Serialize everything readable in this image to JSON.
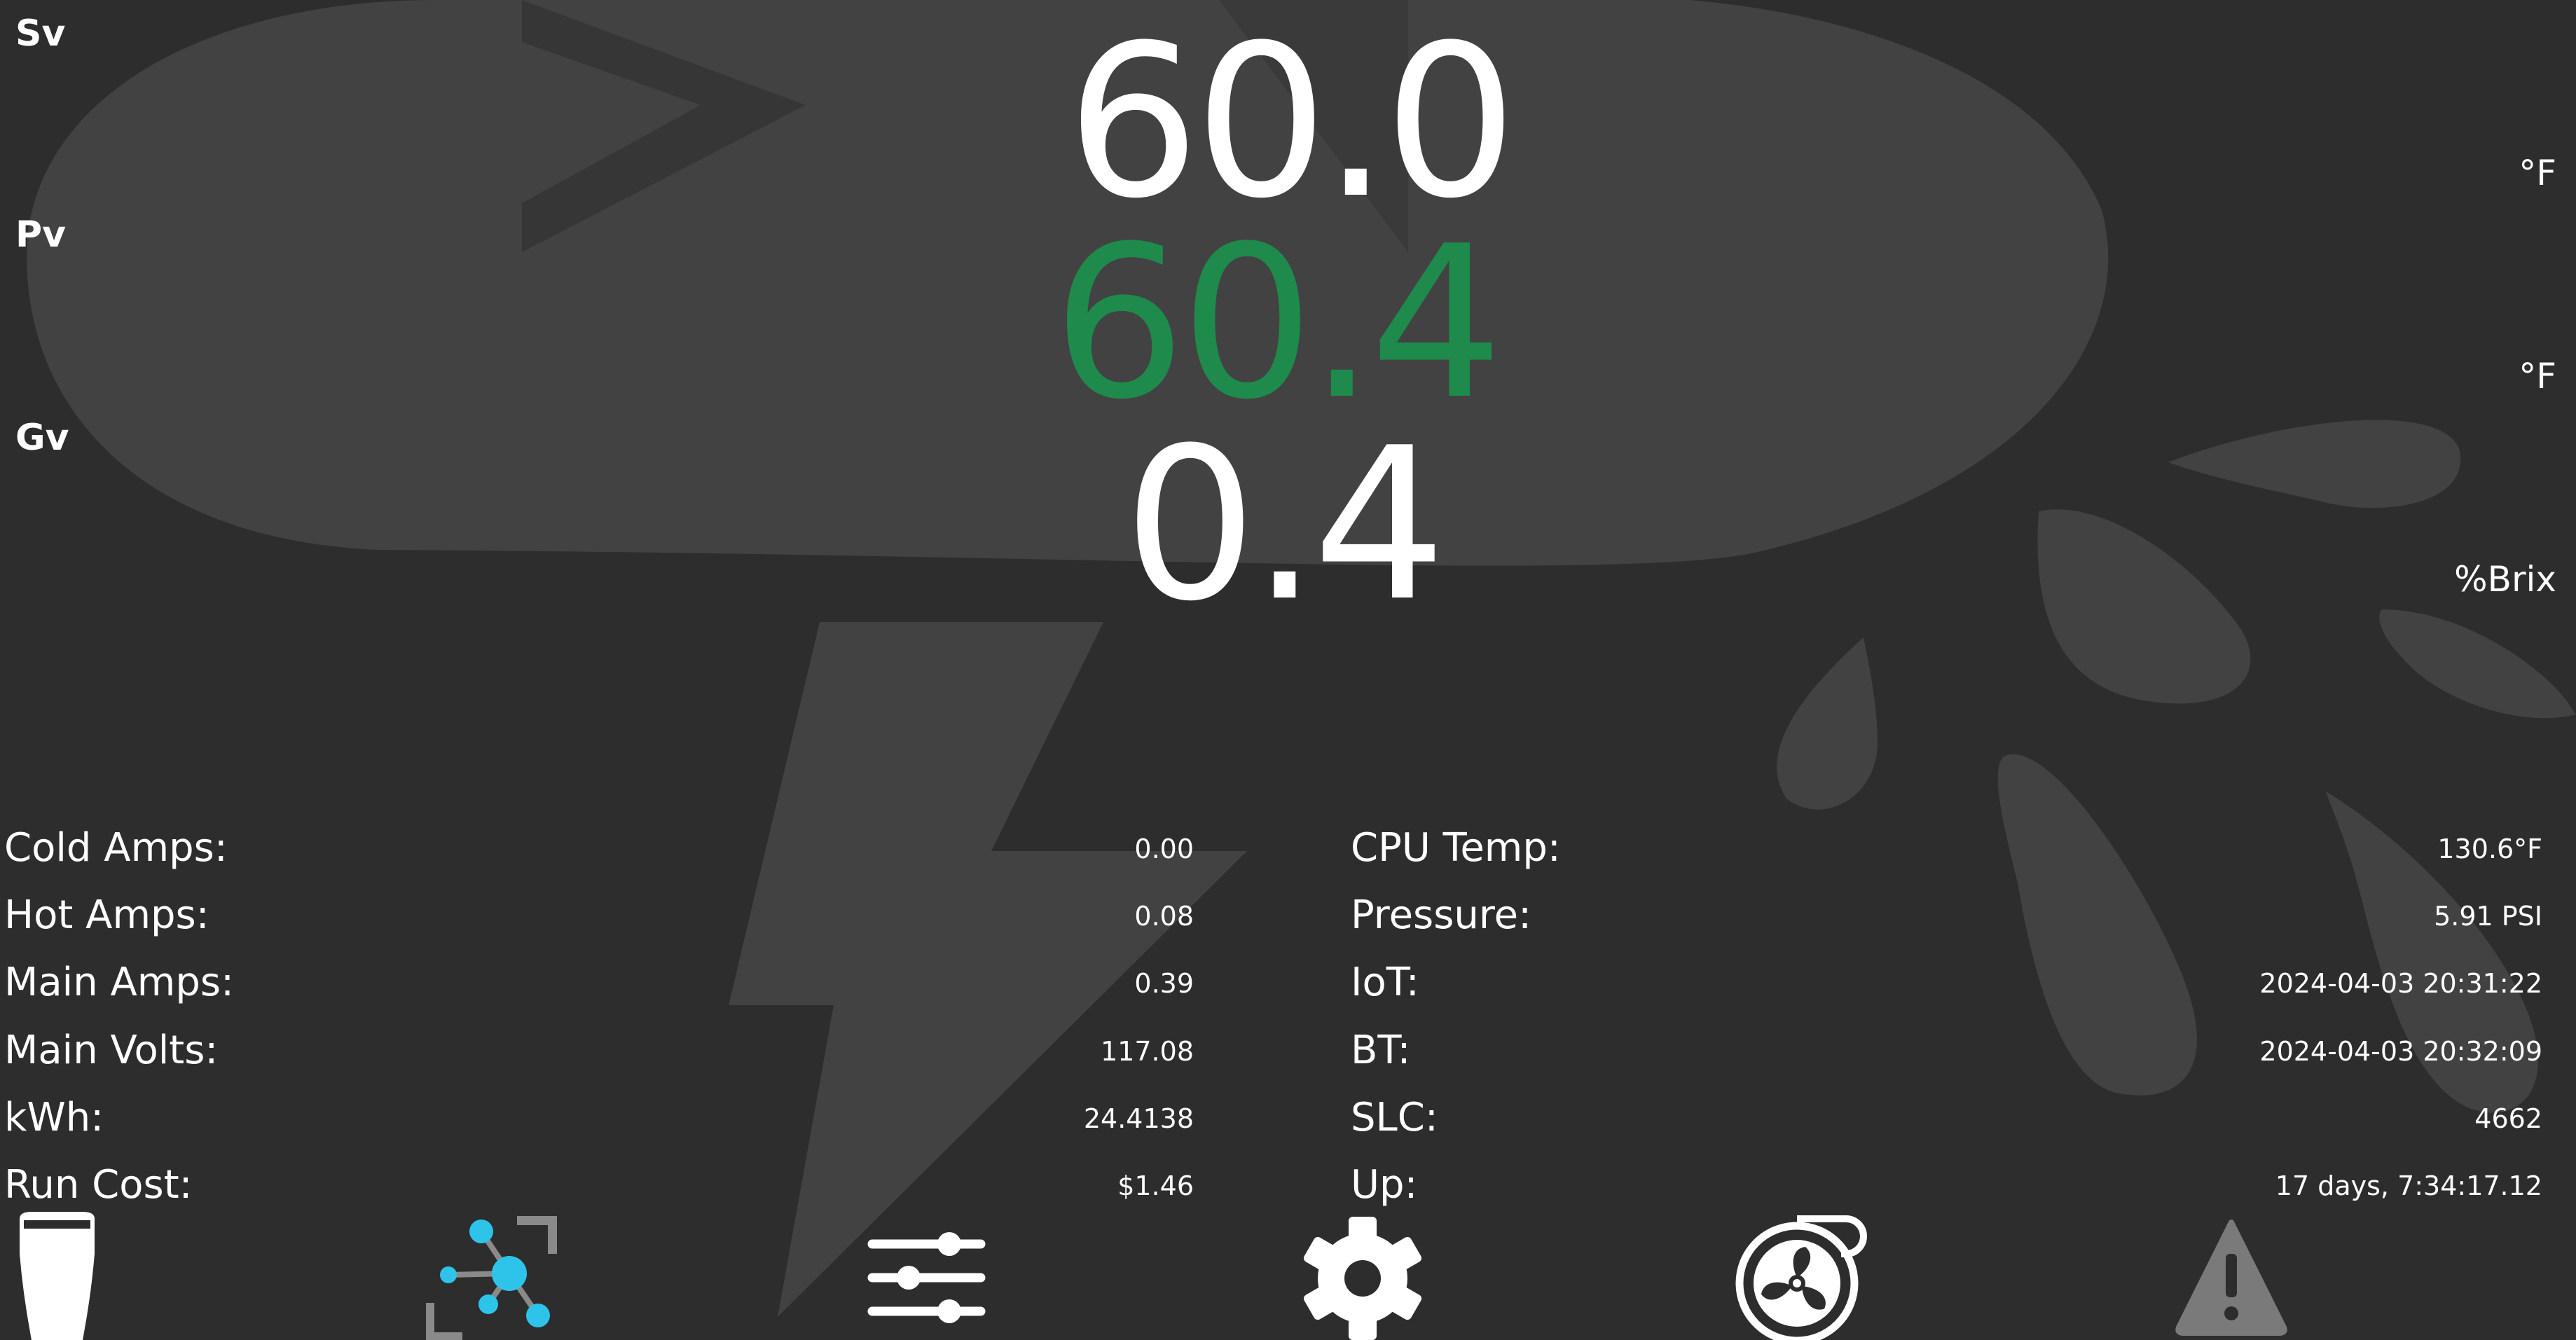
{
  "side_labels": {
    "sv": "Sv",
    "pv": "Pv",
    "gv": "Gv"
  },
  "readings": {
    "sv": "60.0",
    "pv": "60.4",
    "gv": "0.4"
  },
  "units": {
    "sv": "°F",
    "pv": "°F",
    "gv": "%Brix"
  },
  "colors": {
    "background": "#2d2d2d",
    "pv_value": "#1e8a4c",
    "accent_network": "#2ec4ea",
    "nav_icon_inactive": "#7a7a7a"
  },
  "left_stats": [
    {
      "label": "Cold Amps:",
      "value": "0.00"
    },
    {
      "label": "Hot Amps:",
      "value": "0.08"
    },
    {
      "label": "Main Amps:",
      "value": "0.39"
    },
    {
      "label": "Main Volts:",
      "value": "117.08"
    },
    {
      "label": "kWh:",
      "value": "24.4138"
    },
    {
      "label": "Run Cost:",
      "value": "$1.46"
    }
  ],
  "right_stats": [
    {
      "label": "CPU Temp:",
      "value": "130.6°F"
    },
    {
      "label": "Pressure:",
      "value": "5.91 PSI"
    },
    {
      "label": "IoT:",
      "value": "2024-04-03 20:31:22"
    },
    {
      "label": "BT:",
      "value": "2024-04-03 20:32:09"
    },
    {
      "label": "SLC:",
      "value": "4662"
    },
    {
      "label": "Up:",
      "value": "17 days, 7:34:17.12"
    }
  ],
  "nav_icons": [
    "glass-icon",
    "network-icon",
    "sliders-icon",
    "gear-icon",
    "fan-icon",
    "warning-icon"
  ]
}
